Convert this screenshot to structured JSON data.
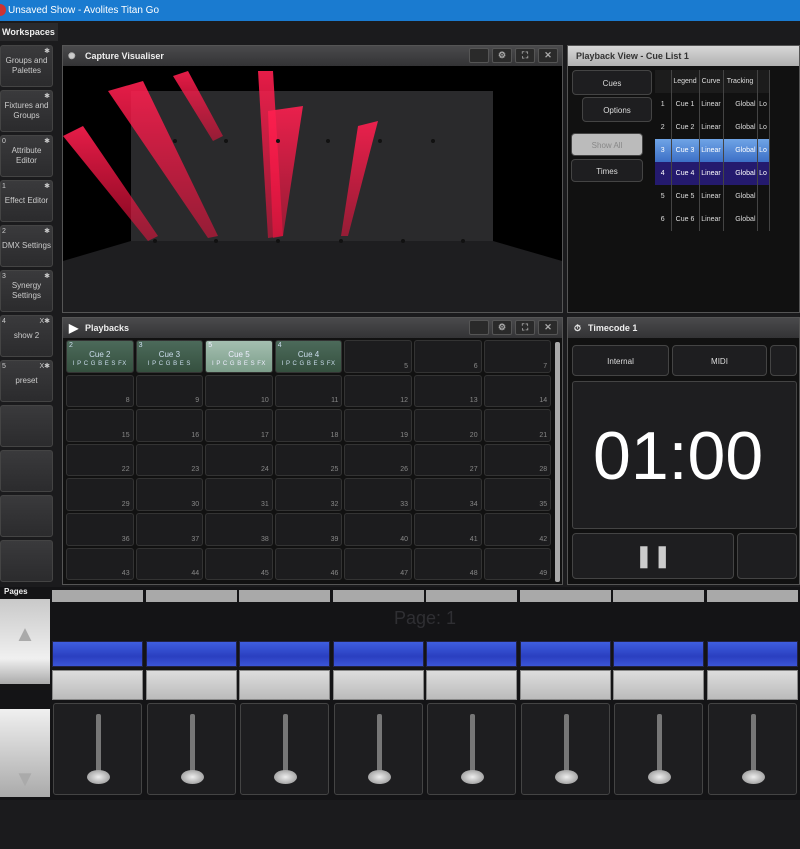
{
  "app": {
    "title": "Unsaved Show - Avolites Titan Go"
  },
  "workspaces": {
    "header": "Workspaces",
    "items": [
      {
        "num": "",
        "label": "Groups and Palettes",
        "pin": "✱"
      },
      {
        "num": "",
        "label": "Fixtures and Groups",
        "pin": "✱"
      },
      {
        "num": "0",
        "label": "Attribute Editor",
        "pin": "✱"
      },
      {
        "num": "1",
        "label": "Effect Editor",
        "pin": "✱"
      },
      {
        "num": "2",
        "label": "DMX Settings",
        "pin": "✱"
      },
      {
        "num": "3",
        "label": "Synergy Settings",
        "pin": "✱"
      },
      {
        "num": "4",
        "label": "show 2",
        "pin": "X✱"
      },
      {
        "num": "5",
        "label": "preset",
        "pin": "X✱"
      }
    ]
  },
  "visualiser": {
    "title": "Capture Visualiser"
  },
  "playback_view": {
    "title": "Playback View - Cue List 1",
    "tabs": [
      "Cues",
      "Options"
    ],
    "buttons": [
      "Show All",
      "Times"
    ],
    "columns": [
      "",
      "Legend",
      "Curve",
      "Tracking",
      ""
    ],
    "rows": [
      [
        "1",
        "Cue 1",
        "Linear",
        "Global",
        "Lo"
      ],
      [
        "2",
        "Cue 2",
        "Linear",
        "Global",
        "Lo"
      ],
      [
        "3",
        "Cue 3",
        "Linear",
        "Global",
        "Lo"
      ],
      [
        "4",
        "Cue 4",
        "Linear",
        "Global",
        "Lo"
      ],
      [
        "5",
        "Cue 5",
        "Linear",
        "Global",
        ""
      ],
      [
        "6",
        "Cue 6",
        "Linear",
        "Global",
        ""
      ]
    ]
  },
  "playbacks": {
    "title": "Playbacks",
    "cues": [
      {
        "top": "2",
        "label": "Cue 2",
        "flags": "I P C G B E S FX"
      },
      {
        "top": "3",
        "label": "Cue 3",
        "flags": "I P C G B E S"
      },
      {
        "top": "5",
        "label": "Cue 5",
        "flags": "I P C G B E S FX"
      },
      {
        "top": "4",
        "label": "Cue 4",
        "flags": "I P C G B E S FX"
      }
    ],
    "cells": [
      "5",
      "6",
      "7",
      "8",
      "9",
      "10",
      "11",
      "12",
      "13",
      "14",
      "15",
      "16",
      "17",
      "18",
      "19",
      "20",
      "21",
      "22",
      "23",
      "24",
      "25",
      "26",
      "27",
      "28",
      "29",
      "30",
      "31",
      "32",
      "33",
      "34",
      "35",
      "36",
      "37",
      "38",
      "39",
      "40",
      "41",
      "42",
      "43",
      "44",
      "45",
      "46",
      "47",
      "48",
      "49"
    ]
  },
  "timecode": {
    "title": "Timecode 1",
    "sources": [
      "Internal",
      "MIDI"
    ],
    "time": "01:00"
  },
  "pages": {
    "label": "Pages",
    "page": "Page: 1"
  }
}
